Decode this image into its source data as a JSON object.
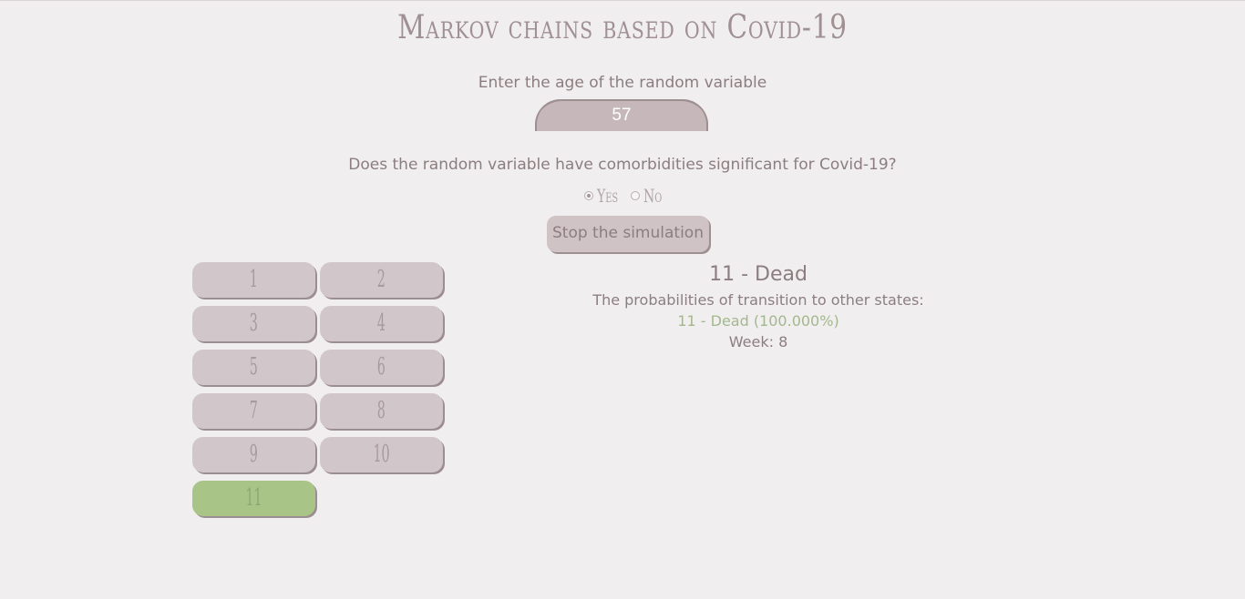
{
  "page": {
    "title": "Markov chains based on Covid-19"
  },
  "age": {
    "label": "Enter the age of the random variable",
    "value": "57"
  },
  "comorbidity": {
    "question": "Does the random variable have comorbidities significant for Covid-19?",
    "options": [
      {
        "label": "Yes",
        "checked": true
      },
      {
        "label": "No",
        "checked": false
      }
    ]
  },
  "controls": {
    "stop_label": "Stop the simulation"
  },
  "states": {
    "items": [
      "1",
      "2",
      "3",
      "4",
      "5",
      "6",
      "7",
      "8",
      "9",
      "10",
      "11"
    ],
    "active": "11"
  },
  "info": {
    "current_state": "11 - Dead",
    "subtitle": "The probabilities of transition to other states:",
    "transition": "11 - Dead (100.000%)",
    "week": "Week: 8"
  },
  "colors": {
    "background": "#f0eeef",
    "text": "#8c7d80",
    "button": "#d1c7ca",
    "active_state": "#a8c487",
    "transition_text": "#a3b88c"
  }
}
